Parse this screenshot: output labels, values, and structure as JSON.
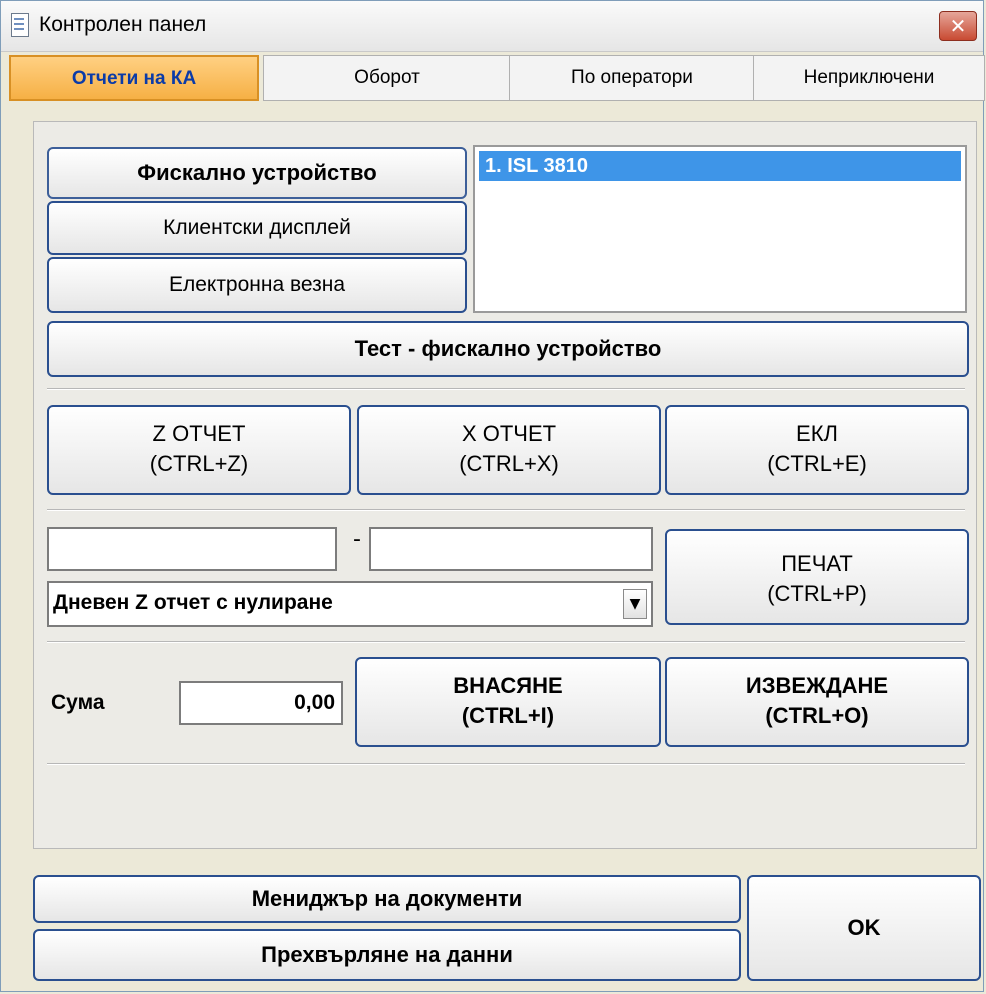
{
  "window": {
    "title": "Контролен панел",
    "close_glyph": "✕"
  },
  "tabs": [
    {
      "label": "Отчети на КА",
      "active": true
    },
    {
      "label": "Оборот",
      "active": false
    },
    {
      "label": "По оператори",
      "active": false
    },
    {
      "label": "Неприключени",
      "active": false
    }
  ],
  "devices": {
    "fiscal": "Фискално устройство",
    "customer_display": "Клиентски дисплей",
    "scale": "Електронна везна",
    "list_selected": "1.  ISL 3810"
  },
  "test_button": "Тест - фискално устройство",
  "reports": {
    "z": {
      "l1": "Z ОТЧЕТ",
      "l2": "(CTRL+Z)"
    },
    "x": {
      "l1": "X ОТЧЕТ",
      "l2": "(CTRL+X)"
    },
    "ekl": {
      "l1": "ЕКЛ",
      "l2": "(CTRL+E)"
    }
  },
  "range": {
    "from": "",
    "to": "",
    "separator": "-"
  },
  "report_type": "Дневен Z отчет с нулиране",
  "print": {
    "l1": "ПЕЧАТ",
    "l2": "(CTRL+P)"
  },
  "sum": {
    "label": "Сума",
    "value": "0,00"
  },
  "cash_in": {
    "l1": "ВНАСЯНЕ",
    "l2": "(CTRL+I)"
  },
  "cash_out": {
    "l1": "ИЗВЕЖДАНЕ",
    "l2": "(CTRL+O)"
  },
  "footer": {
    "document_manager": "Мениджър на документи",
    "data_transfer": "Прехвърляне на данни",
    "ok": "OK"
  },
  "colors": {
    "active_tab": "#f6b045",
    "selection": "#3e95e8",
    "button_border": "#2a4f8f"
  },
  "icons": {
    "app": "document-icon",
    "close": "close-icon",
    "dropdown": "dropdown-arrow-icon"
  }
}
